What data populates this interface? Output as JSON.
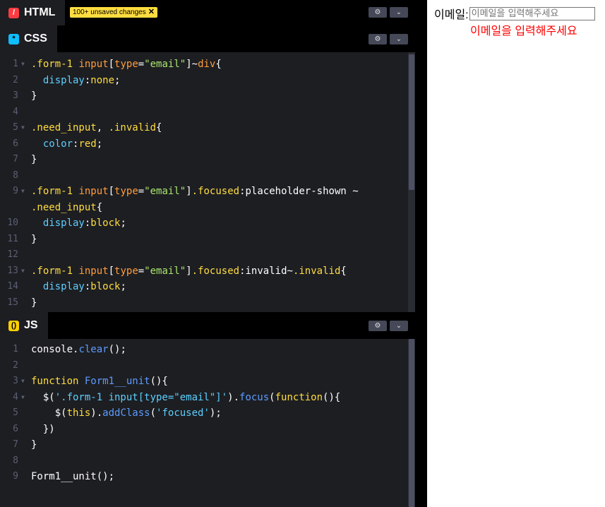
{
  "html_panel": {
    "tab_label": "HTML",
    "unsaved_badge": "100+ unsaved changes"
  },
  "css_panel": {
    "tab_label": "CSS",
    "lines": [
      [
        [
          ".form-1 ",
          "c-sel"
        ],
        [
          "input",
          "c-tag"
        ],
        [
          "[",
          "c-pun"
        ],
        [
          "type",
          "c-attr"
        ],
        [
          "=",
          "c-pun"
        ],
        [
          "\"email\"",
          "c-str"
        ],
        [
          "]~",
          "c-pun"
        ],
        [
          "div",
          "c-tag"
        ],
        [
          "{",
          "c-pun"
        ]
      ],
      [
        [
          "  display",
          "c-prop"
        ],
        [
          ":",
          "c-pun"
        ],
        [
          "none",
          "c-val"
        ],
        [
          ";",
          "c-pun"
        ]
      ],
      [
        [
          "}",
          "c-pun"
        ]
      ],
      [],
      [
        [
          ".need_input",
          "c-sel"
        ],
        [
          ", ",
          "c-pun"
        ],
        [
          ".invalid",
          "c-sel"
        ],
        [
          "{",
          "c-pun"
        ]
      ],
      [
        [
          "  color",
          "c-prop"
        ],
        [
          ":",
          "c-pun"
        ],
        [
          "red",
          "c-val"
        ],
        [
          ";",
          "c-pun"
        ]
      ],
      [
        [
          "}",
          "c-pun"
        ]
      ],
      [],
      [
        [
          ".form-1 ",
          "c-sel"
        ],
        [
          "input",
          "c-tag"
        ],
        [
          "[",
          "c-pun"
        ],
        [
          "type",
          "c-attr"
        ],
        [
          "=",
          "c-pun"
        ],
        [
          "\"email\"",
          "c-str"
        ],
        [
          "]",
          "c-pun"
        ],
        [
          ".focused",
          "c-sel"
        ],
        [
          ":placeholder-shown ~",
          "c-pun"
        ]
      ],
      [
        [
          ".need_input",
          "c-sel"
        ],
        [
          "{",
          "c-pun"
        ]
      ],
      [
        [
          "  display",
          "c-prop"
        ],
        [
          ":",
          "c-pun"
        ],
        [
          "block",
          "c-val"
        ],
        [
          ";",
          "c-pun"
        ]
      ],
      [
        [
          "}",
          "c-pun"
        ]
      ],
      [],
      [
        [
          ".form-1 ",
          "c-sel"
        ],
        [
          "input",
          "c-tag"
        ],
        [
          "[",
          "c-pun"
        ],
        [
          "type",
          "c-attr"
        ],
        [
          "=",
          "c-pun"
        ],
        [
          "\"email\"",
          "c-str"
        ],
        [
          "]",
          "c-pun"
        ],
        [
          ".focused",
          "c-sel"
        ],
        [
          ":invalid~",
          "c-pun"
        ],
        [
          ".invalid",
          "c-sel"
        ],
        [
          "{",
          "c-pun"
        ]
      ],
      [
        [
          "  display",
          "c-prop"
        ],
        [
          ":",
          "c-pun"
        ],
        [
          "block",
          "c-val"
        ],
        [
          ";",
          "c-pun"
        ]
      ],
      [
        [
          "}",
          "c-pun"
        ]
      ]
    ],
    "line_numbers": [
      "1",
      "2",
      "3",
      "4",
      "5",
      "6",
      "7",
      "8",
      "9",
      "",
      "10",
      "11",
      "12",
      "13",
      "14",
      "15"
    ]
  },
  "js_panel": {
    "tab_label": "JS",
    "lines": [
      [
        [
          "console.",
          "c-pun"
        ],
        [
          "clear",
          "c-fn"
        ],
        [
          "();",
          "c-pun"
        ]
      ],
      [],
      [
        [
          "function ",
          "c-kw"
        ],
        [
          "Form1__unit",
          "c-fn"
        ],
        [
          "(){",
          "c-pun"
        ]
      ],
      [
        [
          "  $(",
          "c-pun"
        ],
        [
          "'.form-1 input[type=\"email\"]'",
          "c-js-str"
        ],
        [
          ").",
          "c-pun"
        ],
        [
          "focus",
          "c-fn"
        ],
        [
          "(",
          "c-pun"
        ],
        [
          "function",
          "c-kw"
        ],
        [
          "(){",
          "c-pun"
        ]
      ],
      [
        [
          "    $(",
          "c-pun"
        ],
        [
          "this",
          "c-kw"
        ],
        [
          ").",
          "c-pun"
        ],
        [
          "addClass",
          "c-fn"
        ],
        [
          "(",
          "c-pun"
        ],
        [
          "'focused'",
          "c-js-str"
        ],
        [
          ");",
          "c-pun"
        ]
      ],
      [
        [
          "  })",
          "c-pun"
        ]
      ],
      [
        [
          "}",
          "c-pun"
        ]
      ],
      [],
      [
        [
          "Form1__unit();",
          "c-pun"
        ]
      ]
    ],
    "line_numbers": [
      "1",
      "2",
      "3",
      "4",
      "5",
      "6",
      "7",
      "8",
      "9"
    ]
  },
  "preview": {
    "email_label": "이메일:",
    "email_placeholder": "이메일을 입력해주세요",
    "need_input_msg": "이메일을 입력해주세요"
  }
}
